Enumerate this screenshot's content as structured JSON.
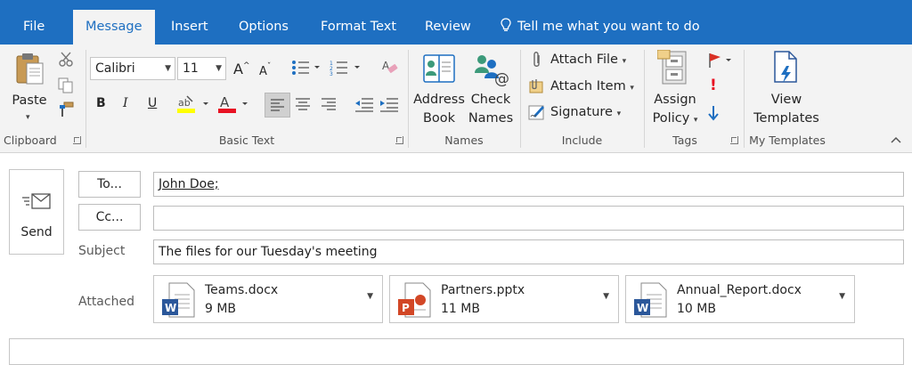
{
  "tabs": [
    {
      "label": "File"
    },
    {
      "label": "Message"
    },
    {
      "label": "Insert"
    },
    {
      "label": "Options"
    },
    {
      "label": "Format Text"
    },
    {
      "label": "Review"
    }
  ],
  "tell_me": "Tell me what you want to do",
  "ribbon": {
    "clipboard": {
      "paste": "Paste",
      "group": "Clipboard"
    },
    "basic_text": {
      "font": "Calibri",
      "size": "11",
      "bold": "B",
      "italic": "I",
      "underline": "U",
      "grow": "A",
      "shrink": "A",
      "font_color_letter": "A",
      "group": "Basic Text"
    },
    "names": {
      "address_1": "Address",
      "address_2": "Book",
      "check_1": "Check",
      "check_2": "Names",
      "group": "Names"
    },
    "include": {
      "attach_file": "Attach File",
      "attach_item": "Attach Item",
      "signature": "Signature",
      "group": "Include"
    },
    "tags": {
      "assign_1": "Assign",
      "assign_2": "Policy",
      "high_importance": "!",
      "group": "Tags"
    },
    "templates": {
      "view_1": "View",
      "view_2": "Templates",
      "group": "My Templates"
    }
  },
  "compose": {
    "send": "Send",
    "to_button": "To...",
    "cc_button": "Cc...",
    "to_value": "John Doe;",
    "cc_value": "",
    "subject_label": "Subject",
    "subject_value": "The files for our Tuesday's meeting",
    "attached_label": "Attached",
    "attachments": [
      {
        "name": "Teams.docx",
        "size": "9 MB",
        "type": "word",
        "badge": "W"
      },
      {
        "name": "Partners.pptx",
        "size": "11 MB",
        "type": "powerpoint",
        "badge": "P"
      },
      {
        "name": "Annual_Report.docx",
        "size": "10 MB",
        "type": "word",
        "badge": "W"
      }
    ]
  },
  "colors": {
    "accent": "#1e6fc1",
    "ribbon_bg": "#f3f3f3",
    "word_blue": "#2b579a",
    "powerpoint_orange": "#d24726",
    "font_color_red": "#e81123",
    "highlight_yellow": "#ffff00",
    "flag_red": "#d93025",
    "arrow_blue": "#1e6fc1"
  },
  "icons": [
    "lightbulb-icon",
    "paste-icon",
    "cut-icon",
    "copy-icon",
    "format-painter-icon",
    "address-book-icon",
    "check-names-icon",
    "paperclip-icon",
    "attach-item-icon",
    "signature-icon",
    "assign-policy-icon",
    "follow-up-flag-icon",
    "high-importance-icon",
    "low-importance-icon",
    "view-templates-icon",
    "send-icon",
    "word-file-icon",
    "powerpoint-file-icon"
  ]
}
